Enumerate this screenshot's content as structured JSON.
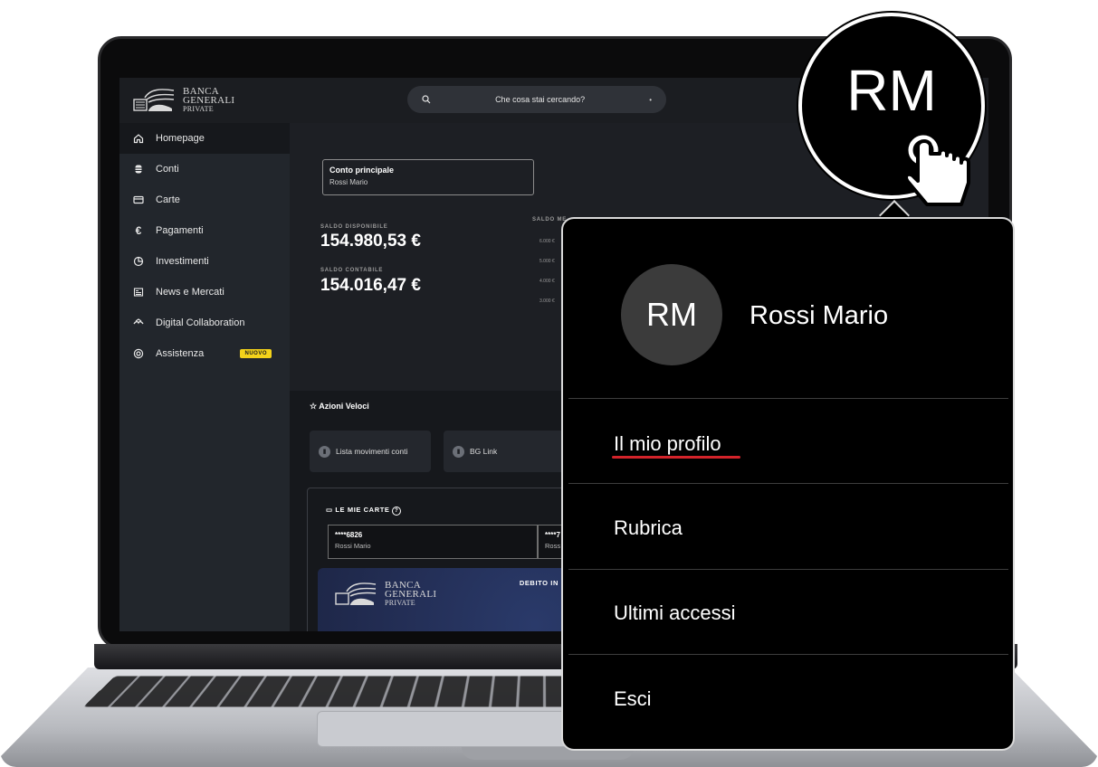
{
  "app": {
    "brand_line1": "BANCA",
    "brand_line2": "GENERALI",
    "brand_line3": "PRIVATE"
  },
  "search": {
    "placeholder": "Che cosa stai cercando?"
  },
  "sidebar": {
    "items": [
      {
        "label": "Homepage",
        "icon": "home-icon"
      },
      {
        "label": "Conti",
        "icon": "database-icon"
      },
      {
        "label": "Carte",
        "icon": "card-icon"
      },
      {
        "label": "Pagamenti",
        "icon": "euro-icon"
      },
      {
        "label": "Investimenti",
        "icon": "pie-chart-icon"
      },
      {
        "label": "News e Mercati",
        "icon": "newspaper-icon"
      },
      {
        "label": "Digital Collaboration",
        "icon": "collaboration-icon"
      },
      {
        "label": "Assistenza",
        "icon": "lifebuoy-icon",
        "badge": "NUOVO"
      }
    ]
  },
  "account": {
    "title": "Conto principale",
    "owner": "Rossi Mario",
    "available_label": "SALDO DISPONIBILE",
    "available_value": "154.980,53 €",
    "accounting_label": "SALDO CONTABILE",
    "accounting_value": "154.016,47 €",
    "chart_label": "SALDO ME",
    "chart_ticks": [
      "6.000 €",
      "5.000 €",
      "4.000 €",
      "3.000 €"
    ]
  },
  "quick_actions": {
    "title": "Azioni Veloci",
    "items": [
      "Lista movimenti conti",
      "BG Link"
    ]
  },
  "cards": {
    "title": "LE MIE CARTE",
    "tabs": [
      {
        "number": "****6826",
        "owner": "Rossi Mario"
      },
      {
        "number": "****7",
        "owner": "Ross"
      }
    ],
    "card_type": "DEBITO IN"
  },
  "profile": {
    "initials": "RM",
    "name": "Rossi Mario",
    "menu": [
      "Il mio profilo",
      "Rubrica",
      "Ultimi accessi",
      "Esci"
    ]
  },
  "colors": {
    "accent_underline": "#d3232a",
    "badge": "#f3d21a"
  }
}
